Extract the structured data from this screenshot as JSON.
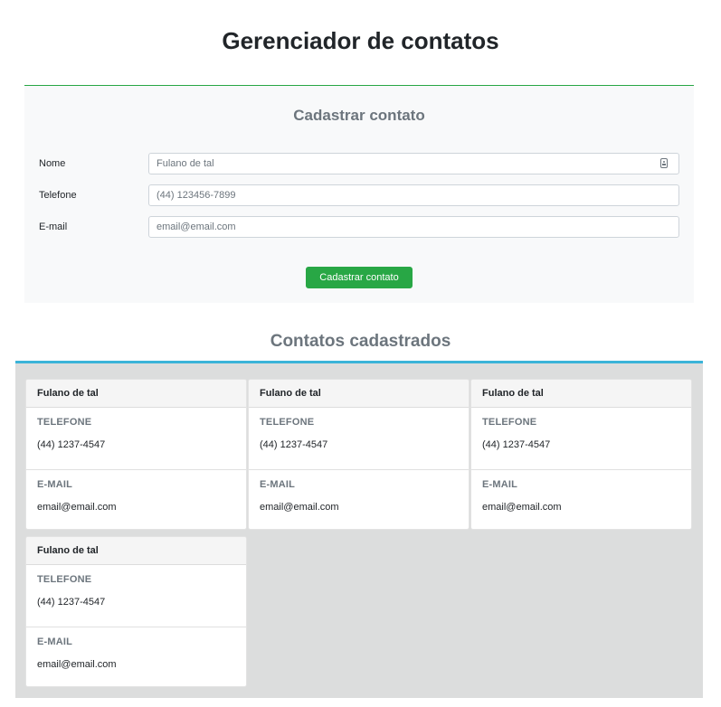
{
  "page": {
    "title": "Gerenciador de contatos"
  },
  "form": {
    "title": "Cadastrar contato",
    "fields": [
      {
        "label": "Nome",
        "placeholder": "Fulano de tal"
      },
      {
        "label": "Telefone",
        "placeholder": "(44) 123456-7899"
      },
      {
        "label": "E-mail",
        "placeholder": "email@email.com"
      }
    ],
    "submit_label": "Cadastrar contato",
    "accent_color": "#28a745"
  },
  "contacts": {
    "title": "Contatos cadastrados",
    "accent_color": "#3bb4d8",
    "phone_label": "TELEFONE",
    "email_label": "E-MAIL",
    "items": [
      {
        "name": "Fulano de tal",
        "phone": "(44) 1237-4547",
        "email": "email@email.com"
      },
      {
        "name": "Fulano de tal",
        "phone": "(44) 1237-4547",
        "email": "email@email.com"
      },
      {
        "name": "Fulano de tal",
        "phone": "(44) 1237-4547",
        "email": "email@email.com"
      },
      {
        "name": "Fulano de tal",
        "phone": "(44) 1237-4547",
        "email": "email@email.com"
      }
    ]
  }
}
